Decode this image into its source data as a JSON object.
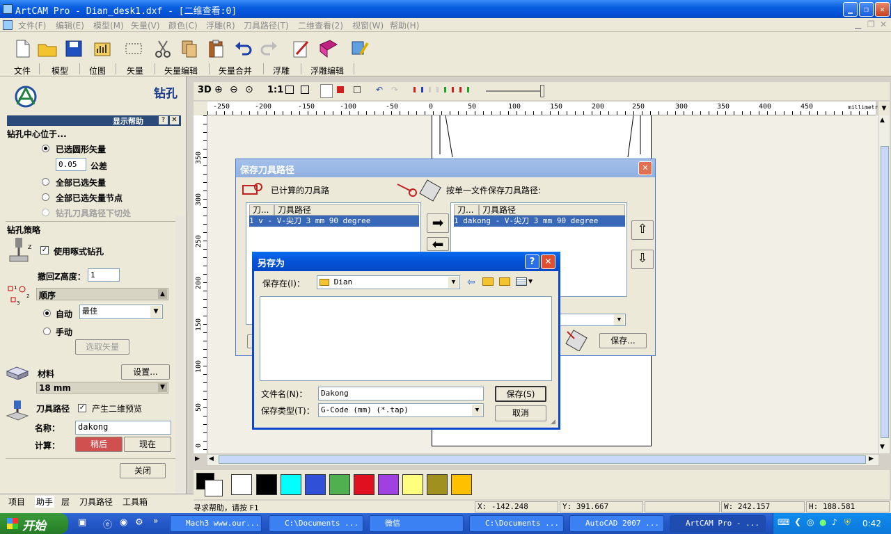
{
  "window": {
    "title": "ArtCAM Pro - Dian_desk1.dxf - [二维查看:0]"
  },
  "menu": [
    "文件(F)",
    "编辑(E)",
    "模型(M)",
    "矢量(V)",
    "颜色(C)",
    "浮雕(R)",
    "刀具路径(T)",
    "二维查看(2)",
    "视窗(W)",
    "帮助(H)"
  ],
  "toolbar_tabs": [
    "文件",
    "模型",
    "位图",
    "矢量",
    "矢量编辑",
    "矢量合并",
    "浮雕",
    "浮雕编辑"
  ],
  "left_panel": {
    "title": "钻孔",
    "help_bar": "显示帮助",
    "section_center": "钻孔中心位于...",
    "opt_selected_circles": "已选圆形矢量",
    "tolerance_value": "0.05",
    "tolerance_label": "公差",
    "opt_all_selected": "全部已选矢量",
    "opt_all_nodes": "全部已选矢量节点",
    "opt_cut_under": "钻孔刀具路径下切处",
    "section_strategy": "钻孔策略",
    "peck_label": "使用啄式钻孔",
    "retract_label": "撤回Z高度：",
    "retract_value": "1",
    "order_header": "顺序",
    "auto_label": "自动",
    "auto_value": "最佳",
    "manual_label": "手动",
    "select_vectors_button": "选取矢量",
    "material_label": "材料",
    "setup_button": "设置...",
    "material_value": "18 mm",
    "toolpath_label": "刀具路径",
    "preview_label": "产生二维预览",
    "name_label": "名称：",
    "name_value": "dakong",
    "calc_label": "计算：",
    "later_button": "稍后",
    "now_button": "现在",
    "close_button": "关闭"
  },
  "left_tabs": [
    "项目",
    "助手",
    "层",
    "刀具路径",
    "工具箱"
  ],
  "view_toolbar": {
    "mode_3d": "3D",
    "scale_1to1": "1:1"
  },
  "ruler": {
    "unit": "millimetres",
    "h_ticks": [
      "-250",
      "-200",
      "-150",
      "-100",
      "-50",
      "0",
      "50",
      "100",
      "150",
      "200",
      "250",
      "300",
      "350",
      "400",
      "450"
    ],
    "v_ticks": [
      "350",
      "300",
      "250",
      "200",
      "150",
      "100",
      "50",
      "0"
    ]
  },
  "save_toolpath_dialog": {
    "title": "保存刀具路径",
    "calculated_label": "已计算的刀具路",
    "single_file_label": "按单一文件保存刀具路径:",
    "col_no": "刀...",
    "col_path": "刀具路径",
    "left_row": "1   v - V-尖刀 3 mm 90 degree",
    "right_row": "1   dakong - V-尖刀 3 mm 90 degree",
    "partial_label": "：",
    "save_button": "保存..."
  },
  "save_as_dialog": {
    "title": "另存为",
    "save_in_label": "保存在(I)：",
    "save_in_value": "Dian",
    "filename_label": "文件名(N)：",
    "filename_value": "Dakong",
    "filetype_label": "保存类型(T)：",
    "filetype_value": "G-Code (mm) (*.tap)",
    "save_button": "保存(S)",
    "cancel_button": "取消",
    "help_button": "?"
  },
  "status": {
    "hint": "寻求帮助，请按 F1",
    "x": "X: -142.248",
    "y": "Y: 391.667",
    "w": "W: 242.157",
    "h": "H: 188.581"
  },
  "palette_colors": [
    "#ffffff",
    "#000000",
    "#00ffff",
    "#3050d8",
    "#50b050",
    "#e01020",
    "#a040e0",
    "#ffff80",
    "#a09020",
    "#ffc000"
  ],
  "taskbar": {
    "start": "开始",
    "tasks": [
      "Mach3 www.our...",
      "C:\\Documents ...",
      "微信",
      "C:\\Documents ...",
      "AutoCAD 2007 ...",
      "ArtCAM Pro - ..."
    ],
    "clock": "0:42"
  }
}
